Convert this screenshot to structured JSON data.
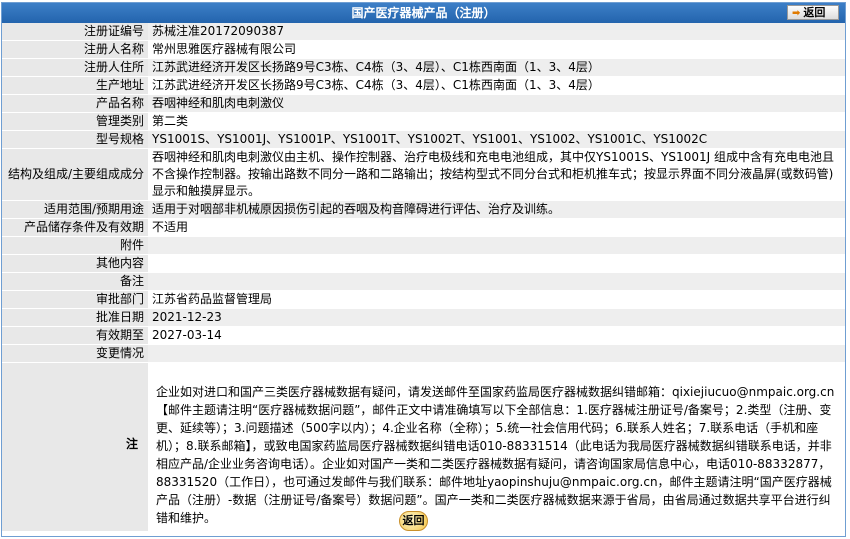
{
  "header": {
    "title": "国产医疗器械产品（注册）",
    "back_label": "返回"
  },
  "rows": [
    {
      "label": "注册证编号",
      "value": "苏械注准20172090387"
    },
    {
      "label": "注册人名称",
      "value": "常州思雅医疗器械有限公司"
    },
    {
      "label": "注册人住所",
      "value": "江苏武进经济开发区长扬路9号C3栋、C4栋（3、4层）、C1栋西南面（1、3、4层）"
    },
    {
      "label": "生产地址",
      "value": "江苏武进经济开发区长扬路9号C3栋、C4栋（3、4层）、C1栋西南面（1、3、4层）"
    },
    {
      "label": "产品名称",
      "value": "吞咽神经和肌肉电刺激仪"
    },
    {
      "label": "管理类别",
      "value": "第二类"
    },
    {
      "label": "型号规格",
      "value": "YS1001S、YS1001J、YS1001P、YS1001T、YS1002T、YS1001、YS1002、YS1001C、YS1002C"
    },
    {
      "label": "结构及组成/主要组成成分",
      "value": "吞咽神经和肌肉电刺激仪由主机、操作控制器、治疗电极线和充电电池组成，其中仅YS1001S、YS1001J 组成中含有充电电池且不含操作控制器。按输出路数不同分一路和二路输出；按结构型式不同分台式和柜机推车式；按显示界面不同分液晶屏(或数码管)显示和触摸屏显示。"
    },
    {
      "label": "适用范围/预期用途",
      "value": "适用于对咽部非机械原因损伤引起的吞咽及构音障碍进行评估、治疗及训练。"
    },
    {
      "label": "产品储存条件及有效期",
      "value": "不适用"
    },
    {
      "label": "附件",
      "value": ""
    },
    {
      "label": "其他内容",
      "value": ""
    },
    {
      "label": "备注",
      "value": ""
    },
    {
      "label": "审批部门",
      "value": "江苏省药品监督管理局"
    },
    {
      "label": "批准日期",
      "value": "2021-12-23"
    },
    {
      "label": "有效期至",
      "value": "2027-03-14"
    },
    {
      "label": "变更情况",
      "value": ""
    }
  ],
  "note": {
    "label": "注",
    "text": "企业如对进口和国产三类医疗器械数据有疑问，请发送邮件至国家药监局医疗器械数据纠错邮箱：qixiejiucuo@nmpaic.org.cn【邮件主题请注明“医疗器械数据问题”，邮件正文中请准确填写以下全部信息：1.医疗器械注册证号/备案号；2.类型（注册、变更、延续等）；3.问题描述（500字以内）；4.企业名称（全称）；5.统一社会信用代码；6.联系人姓名；7.联系电话（手机和座机）；8.联系邮箱】，或致电国家药监局医疗器械数据纠错电话010-88331514（此电话为我局医疗器械数据纠错联系电话，并非相应产品/企业业务咨询电话）。企业如对国产一类和二类医疗器械数据有疑问，请咨询国家局信息中心，电话010-88332877，88331520（工作日），也可通过发邮件与我们联系：邮件地址yaopinshuju@nmpaic.org.cn，邮件主题请注明“国产医疗器械产品（注册）-数据（注册证号/备案号）数据问题”。国产一类和二类医疗器械数据来源于省局，由省局通过数据共享平台进行纠错和维护。"
  },
  "footer": {
    "back_label": "返回"
  }
}
